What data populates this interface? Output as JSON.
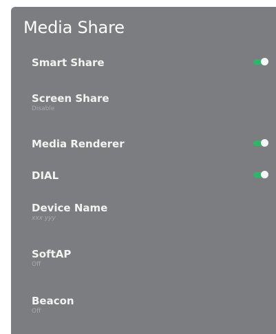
{
  "panel": {
    "title": "Media Share"
  },
  "items": [
    {
      "label": "Smart Share",
      "sub": "",
      "toggle": true
    },
    {
      "label": "Screen Share",
      "sub": "Disable",
      "toggle": false
    },
    {
      "label": "Media Renderer",
      "sub": "",
      "toggle": true
    },
    {
      "label": "DIAL",
      "sub": "",
      "toggle": true
    },
    {
      "label": "Device Name",
      "sub": "xxx yyy",
      "toggle": false
    },
    {
      "label": "SoftAP",
      "sub": "Off",
      "toggle": false
    },
    {
      "label": "Beacon",
      "sub": "Off",
      "toggle": false
    }
  ],
  "colors": {
    "panel_bg": "#7c7d80",
    "toggle_on": "#2fb56a",
    "text_primary": "#f3f3f3",
    "text_secondary": "#a9aaac"
  }
}
